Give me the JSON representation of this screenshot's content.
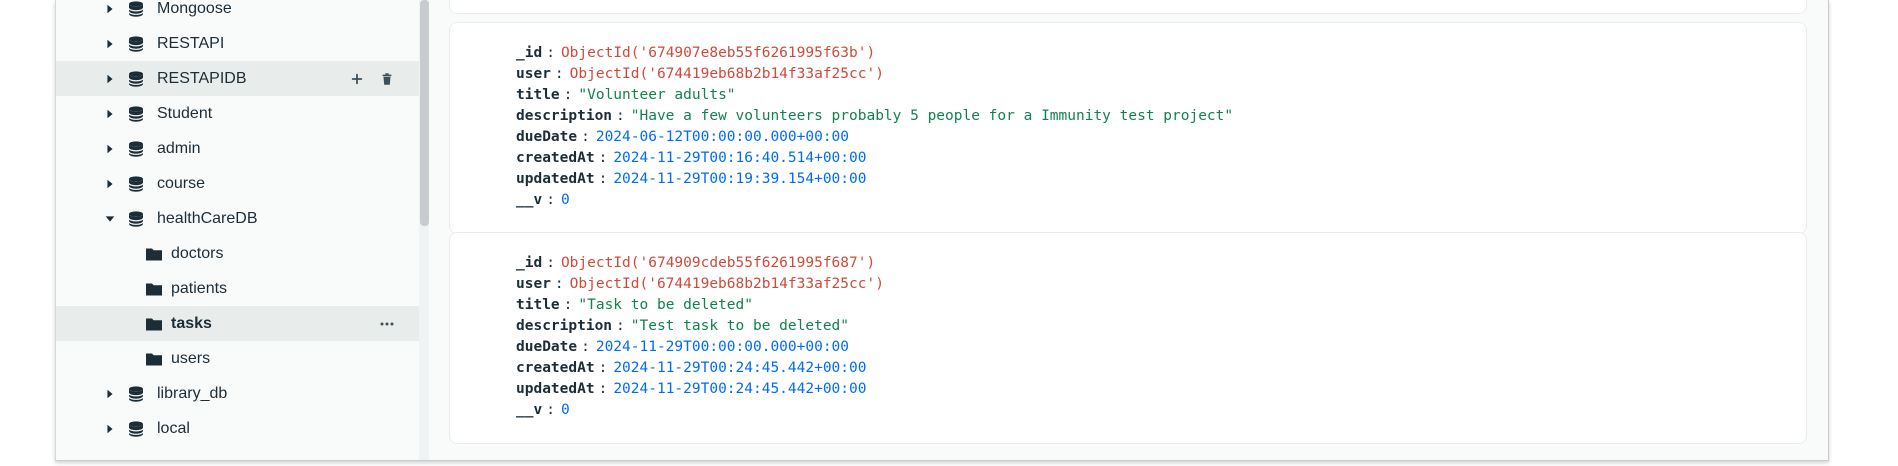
{
  "sidebar": {
    "items": [
      {
        "label": "Mongoose",
        "kind": "database",
        "expanded": false,
        "selected": false,
        "hovered": false
      },
      {
        "label": "RESTAPI",
        "kind": "database",
        "expanded": false,
        "selected": false,
        "hovered": false
      },
      {
        "label": "RESTAPIDB",
        "kind": "database",
        "expanded": false,
        "selected": false,
        "hovered": true
      },
      {
        "label": "Student",
        "kind": "database",
        "expanded": false,
        "selected": false,
        "hovered": false
      },
      {
        "label": "admin",
        "kind": "database",
        "expanded": false,
        "selected": false,
        "hovered": false
      },
      {
        "label": "course",
        "kind": "database",
        "expanded": false,
        "selected": false,
        "hovered": false
      },
      {
        "label": "healthCareDB",
        "kind": "database",
        "expanded": true,
        "selected": false,
        "hovered": false
      },
      {
        "label": "doctors",
        "kind": "collection",
        "selected": false
      },
      {
        "label": "patients",
        "kind": "collection",
        "selected": false
      },
      {
        "label": "tasks",
        "kind": "collection",
        "selected": true
      },
      {
        "label": "users",
        "kind": "collection",
        "selected": false
      },
      {
        "label": "library_db",
        "kind": "database",
        "expanded": false,
        "selected": false,
        "hovered": false
      },
      {
        "label": "local",
        "kind": "database",
        "expanded": false,
        "selected": false,
        "hovered": false
      }
    ]
  },
  "documents": [
    {
      "fields": [
        {
          "key": "_id",
          "value": "ObjectId('674907e8eb55f6261995f63b')",
          "type": "objectid"
        },
        {
          "key": "user",
          "value": "ObjectId('674419eb68b2b14f33af25cc')",
          "type": "objectid"
        },
        {
          "key": "title",
          "value": "\"Volunteer adults\"",
          "type": "string"
        },
        {
          "key": "description",
          "value": "\"Have a few volunteers probably 5 people for a Immunity test project\"",
          "type": "string"
        },
        {
          "key": "dueDate",
          "value": "2024-06-12T00:00:00.000+00:00",
          "type": "date"
        },
        {
          "key": "createdAt",
          "value": "2024-11-29T00:16:40.514+00:00",
          "type": "date"
        },
        {
          "key": "updatedAt",
          "value": "2024-11-29T00:19:39.154+00:00",
          "type": "date"
        },
        {
          "key": "__v",
          "value": "0",
          "type": "number"
        }
      ]
    },
    {
      "fields": [
        {
          "key": "_id",
          "value": "ObjectId('674909cdeb55f6261995f687')",
          "type": "objectid"
        },
        {
          "key": "user",
          "value": "ObjectId('674419eb68b2b14f33af25cc')",
          "type": "objectid"
        },
        {
          "key": "title",
          "value": "\"Task to be deleted\"",
          "type": "string"
        },
        {
          "key": "description",
          "value": "\"Test task to be deleted\"",
          "type": "string"
        },
        {
          "key": "dueDate",
          "value": "2024-11-29T00:00:00.000+00:00",
          "type": "date"
        },
        {
          "key": "createdAt",
          "value": "2024-11-29T00:24:45.442+00:00",
          "type": "date"
        },
        {
          "key": "updatedAt",
          "value": "2024-11-29T00:24:45.442+00:00",
          "type": "date"
        },
        {
          "key": "__v",
          "value": "0",
          "type": "number"
        }
      ]
    }
  ],
  "icons": {
    "database": "database-icon",
    "collection": "folder-icon",
    "caret_collapsed": "caret-right-icon",
    "caret_expanded": "caret-down-icon",
    "add": "plus-icon",
    "delete": "trash-icon",
    "more": "ellipsis-icon"
  },
  "colors": {
    "objectid": "#cf4a3a",
    "string": "#12824d",
    "date": "#016bf8",
    "number": "#016bf8",
    "selected_row": "#e8edeb"
  }
}
